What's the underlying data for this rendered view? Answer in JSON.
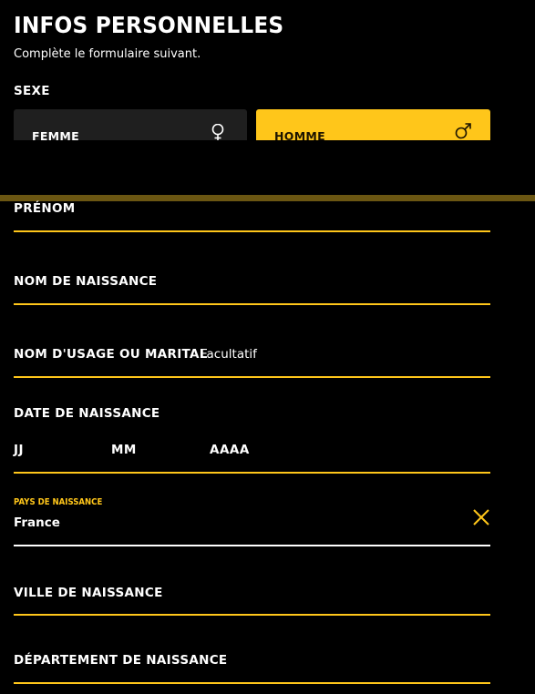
{
  "header": {
    "title": "INFOS PERSONNELLES",
    "subtitle": "Complète le formulaire suivant."
  },
  "sexe": {
    "label": "SEXE",
    "options": [
      {
        "label": "FEMME",
        "icon": "female-symbol-icon",
        "selected": false
      },
      {
        "label": "HOMME",
        "icon": "male-symbol-icon",
        "selected": true
      }
    ]
  },
  "fields": {
    "prenom": {
      "label": "PRÉNOM",
      "value": ""
    },
    "nom_naissance": {
      "label": "NOM DE NAISSANCE",
      "value": ""
    },
    "nom_usage": {
      "label": "NOM D'USAGE OU MARITAL",
      "hint": "Facultatif",
      "value": ""
    },
    "date_naissance": {
      "label": "DATE DE NAISSANCE",
      "day_placeholder": "JJ",
      "month_placeholder": "MM",
      "year_placeholder": "AAAA"
    },
    "pays_naissance": {
      "label": "PAYS DE NAISSANCE",
      "value": "France",
      "clear_icon": "close-icon"
    },
    "ville_naissance": {
      "label": "VILLE DE NAISSANCE",
      "value": ""
    },
    "departement_naissance": {
      "label": "DÉPARTEMENT DE NAISSANCE",
      "value": ""
    }
  },
  "colors": {
    "background": "#000000",
    "accent": "#ffc61a",
    "card_inactive": "#1f1f1f",
    "progress_track": "#6b5612",
    "text": "#ffffff"
  }
}
